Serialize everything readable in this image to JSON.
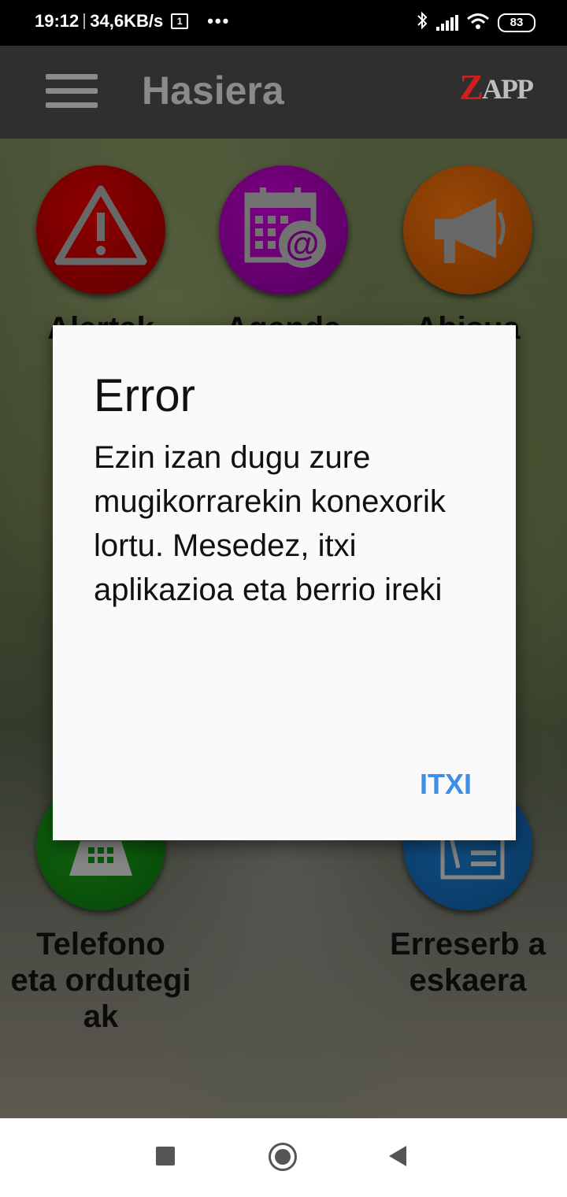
{
  "status_bar": {
    "time": "19:12",
    "speed": "34,6KB/s",
    "sim_indicator": "1",
    "more": "•••",
    "bluetooth_icon": "✱",
    "battery": "83"
  },
  "app_bar": {
    "title": "Hasiera",
    "logo_first": "Z",
    "logo_rest": "APP"
  },
  "tiles": [
    {
      "label": "Alertak",
      "icon": "warning-icon",
      "color": "#b80000"
    },
    {
      "label": "Agenda",
      "icon": "calendar-icon",
      "color": "#a000ad"
    },
    {
      "label": "Abisua",
      "icon": "megaphone-icon",
      "color": "#c85a05"
    },
    {
      "label": "Telefono eta ordutegi ak",
      "icon": "phone-icon",
      "color": "#148014"
    },
    {
      "label": "Erreserb a eskaera",
      "icon": "form-icon",
      "color": "#1468b0"
    }
  ],
  "dialog": {
    "title": "Error",
    "message": "Ezin izan dugu zure mugikorrarekin konexorik lortu. Mesedez, itxi aplikazioa eta berrio ireki",
    "button": "ITXI"
  },
  "colors": {
    "dialog_button": "#3c8ee6",
    "app_bar": "#2f2f2f",
    "logo_red": "#d31e1e"
  }
}
